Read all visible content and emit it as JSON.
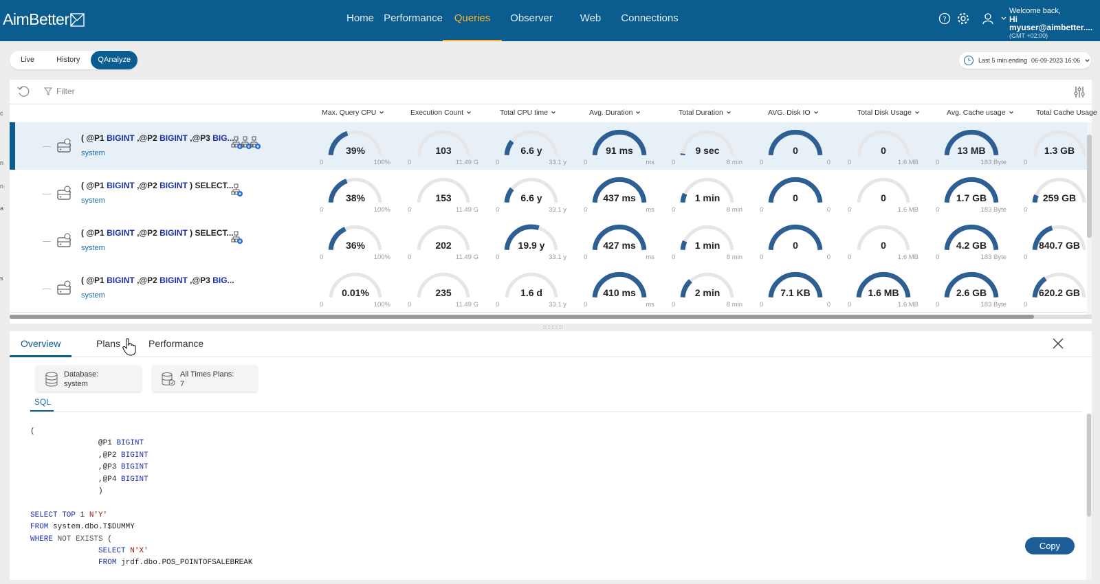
{
  "app": {
    "logo_text": "AimBetter"
  },
  "nav": {
    "items": [
      {
        "label": "Home"
      },
      {
        "label": "Performance"
      },
      {
        "label": "Queries"
      },
      {
        "label": "Observer"
      },
      {
        "label": "Web"
      },
      {
        "label": "Connections"
      }
    ],
    "active": "Queries"
  },
  "user": {
    "welcome": "Welcome back,",
    "name": "Hi myuser@aimbetter....",
    "timezone": "(GMT +02:00)"
  },
  "modes": {
    "items": [
      {
        "label": "Live"
      },
      {
        "label": "History"
      },
      {
        "label": "QAnalyze"
      }
    ],
    "active": "QAnalyze"
  },
  "time_range": {
    "label": "Last 5 min ending",
    "value": "06-09-2023 16:06"
  },
  "filter": {
    "label": "Filter"
  },
  "columns": [
    {
      "label": "Max. Query CPU"
    },
    {
      "label": "Execution Count"
    },
    {
      "label": "Total CPU time"
    },
    {
      "label": "Avg. Duration"
    },
    {
      "label": "Total Duration"
    },
    {
      "label": "AVG. Disk IO"
    },
    {
      "label": "Total Disk Usage"
    },
    {
      "label": "Avg. Cache usage"
    },
    {
      "label": "Total Cache Usage"
    }
  ],
  "rows": [
    {
      "query_prefix": "( ",
      "query_parts": [
        "@P1 BIGINT",
        ",@P2 BIGINT",
        ",@P3 BIG..."
      ],
      "database": "system",
      "plans": 3,
      "cells": [
        {
          "value": "39%",
          "min": "0",
          "max": "100%",
          "fill": 0.39
        },
        {
          "value": "103",
          "min": "0",
          "max": "11.49 G",
          "fill": 0.0
        },
        {
          "value": "6.6 y",
          "min": "0",
          "max": "33.1 y",
          "fill": 0.2
        },
        {
          "value": "91 ms",
          "min": "0",
          "max": "ms",
          "fill": 1.0
        },
        {
          "value": "9 sec",
          "min": "0",
          "max": "8 min",
          "fill": 0.02
        },
        {
          "value": "0",
          "min": "0",
          "max": "0",
          "fill": 1.0
        },
        {
          "value": "0",
          "min": "0",
          "max": "1.6 MB",
          "fill": 0.0
        },
        {
          "value": "13 MB",
          "min": "0",
          "max": "183 Byte",
          "fill": 1.0
        },
        {
          "value": "1.3 GB",
          "min": "0",
          "max": "",
          "fill": 0.0
        }
      ]
    },
    {
      "query_prefix": "( ",
      "query_parts": [
        "@P1 BIGINT",
        ",@P2 BIGINT",
        " ) SELECT..."
      ],
      "database": "system",
      "plans": 1,
      "cells": [
        {
          "value": "38%",
          "min": "0",
          "max": "100%",
          "fill": 0.38
        },
        {
          "value": "153",
          "min": "0",
          "max": "11.49 G",
          "fill": 0.0
        },
        {
          "value": "6.6 y",
          "min": "0",
          "max": "33.1 y",
          "fill": 0.2
        },
        {
          "value": "437 ms",
          "min": "0",
          "max": "ms",
          "fill": 1.0
        },
        {
          "value": "1 min",
          "min": "0",
          "max": "8 min",
          "fill": 0.12
        },
        {
          "value": "0",
          "min": "0",
          "max": "0",
          "fill": 1.0
        },
        {
          "value": "0",
          "min": "0",
          "max": "1.6 MB",
          "fill": 0.0
        },
        {
          "value": "1.7 GB",
          "min": "0",
          "max": "183 Byte",
          "fill": 1.0
        },
        {
          "value": "259 GB",
          "min": "0",
          "max": "",
          "fill": 0.1
        }
      ]
    },
    {
      "query_prefix": "( ",
      "query_parts": [
        "@P1 BIGINT",
        ",@P2 BIGINT",
        " ) SELECT..."
      ],
      "database": "system",
      "plans": 1,
      "cells": [
        {
          "value": "36%",
          "min": "0",
          "max": "100%",
          "fill": 0.36
        },
        {
          "value": "202",
          "min": "0",
          "max": "11.49 G",
          "fill": 0.0
        },
        {
          "value": "19.9 y",
          "min": "0",
          "max": "33.1 y",
          "fill": 0.6
        },
        {
          "value": "427 ms",
          "min": "0",
          "max": "ms",
          "fill": 1.0
        },
        {
          "value": "1 min",
          "min": "0",
          "max": "8 min",
          "fill": 0.12
        },
        {
          "value": "0",
          "min": "0",
          "max": "0",
          "fill": 1.0
        },
        {
          "value": "0",
          "min": "0",
          "max": "1.6 MB",
          "fill": 0.0
        },
        {
          "value": "4.2 GB",
          "min": "0",
          "max": "183 Byte",
          "fill": 1.0
        },
        {
          "value": "840.7 GB",
          "min": "0",
          "max": "",
          "fill": 0.4
        }
      ]
    },
    {
      "query_prefix": "( ",
      "query_parts": [
        "@P1 BIGINT",
        ",@P2 BIGINT",
        ",@P3 BIG..."
      ],
      "database": "system",
      "plans": 0,
      "cells": [
        {
          "value": "0.01%",
          "min": "0",
          "max": "100%",
          "fill": 0.0
        },
        {
          "value": "235",
          "min": "0",
          "max": "11.49 G",
          "fill": 0.0
        },
        {
          "value": "1.6 d",
          "min": "0",
          "max": "33.1 y",
          "fill": 0.0
        },
        {
          "value": "410 ms",
          "min": "0",
          "max": "ms",
          "fill": 1.0
        },
        {
          "value": "2 min",
          "min": "0",
          "max": "8 min",
          "fill": 0.25
        },
        {
          "value": "7.1 KB",
          "min": "0",
          "max": "0",
          "fill": 1.0
        },
        {
          "value": "1.6 MB",
          "min": "0",
          "max": "1.6 MB",
          "fill": 1.0
        },
        {
          "value": "2.6 GB",
          "min": "0",
          "max": "183 Byte",
          "fill": 1.0
        },
        {
          "value": "620.2 GB",
          "min": "0",
          "max": "",
          "fill": 0.3
        }
      ]
    }
  ],
  "detail": {
    "tabs": [
      {
        "label": "Overview"
      },
      {
        "label": "Plans"
      },
      {
        "label": "Performance"
      }
    ],
    "active_tab": "Overview",
    "cards": [
      {
        "label": "Database:",
        "value": "system",
        "icon": "database-icon"
      },
      {
        "label": "All Times Plans:",
        "value": "7",
        "icon": "plans-icon"
      }
    ],
    "subtab": "SQL",
    "copy_label": "Copy",
    "code": {
      "l1": "(",
      "l2_kw": "BIGINT",
      "l2_var": "@P1 ",
      "l3_kw": "BIGINT",
      "l3_var": ",@P2 ",
      "l4_kw": "BIGINT",
      "l4_var": ",@P3 ",
      "l5_kw": "BIGINT",
      "l5_var": ",@P4 ",
      "l6": ")",
      "l8_kw": "SELECT TOP ",
      "l8_num": "1 ",
      "l8_str": "N'Y'",
      "l9_kw": "FROM ",
      "l9_obj": "system.dbo.T$DUMMY",
      "l10_kw": "WHERE ",
      "l10_gr": "NOT EXISTS ",
      "l10_p": "(",
      "l11_kw": "SELECT ",
      "l11_str": "N'X'",
      "l12_kw": "FROM ",
      "l12_obj": "jrdf.dbo.POS_POINTOFSALEBREAK"
    }
  },
  "colors": {
    "brand": "#0b5c8f",
    "accent": "#f7b733",
    "gauge": "#2e5f93",
    "track": "#e6e6e6"
  }
}
